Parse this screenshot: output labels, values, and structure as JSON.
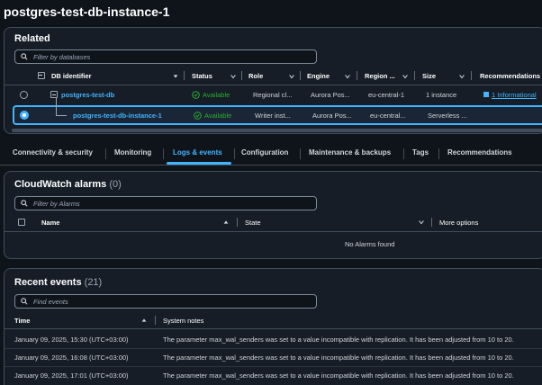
{
  "page": {
    "title": "postgres-test-db-instance-1"
  },
  "related": {
    "title": "Related",
    "search_placeholder": "Filter by databases",
    "columns": {
      "db_identifier": "DB identifier",
      "status": "Status",
      "role": "Role",
      "engine": "Engine",
      "region": "Region ...",
      "size": "Size",
      "recommendations": "Recommendations"
    },
    "rows": [
      {
        "identifier": "postgres-test-db",
        "status": "Available",
        "role": "Regional cl...",
        "engine": "Aurora Pos...",
        "region": "eu-central-1",
        "size": "1 instance",
        "recommendation": "1 Informational",
        "selected": false
      },
      {
        "identifier": "postgres-test-db-instance-1",
        "status": "Available",
        "role": "Writer inst...",
        "engine": "Aurora Pos...",
        "region": "eu-central...",
        "size": "Serverless ...",
        "recommendation": "",
        "selected": true
      }
    ]
  },
  "tabs": [
    {
      "label": "Connectivity & security",
      "active": false
    },
    {
      "label": "Monitoring",
      "active": false
    },
    {
      "label": "Logs & events",
      "active": true
    },
    {
      "label": "Configuration",
      "active": false
    },
    {
      "label": "Maintenance & backups",
      "active": false
    },
    {
      "label": "Tags",
      "active": false
    },
    {
      "label": "Recommendations",
      "active": false
    }
  ],
  "alarms": {
    "title": "CloudWatch alarms",
    "count": "(0)",
    "search_placeholder": "Filter by Alarms",
    "columns": {
      "name": "Name",
      "state": "State",
      "more": "More options"
    },
    "empty": "No Alarms found"
  },
  "events": {
    "title": "Recent events",
    "count": "(21)",
    "search_placeholder": "Find events",
    "columns": {
      "time": "Time",
      "notes": "System notes"
    },
    "rows": [
      {
        "time": "January 09, 2025, 15:30 (UTC+03:00)",
        "note": "The parameter max_wal_senders was set to a value incompatible with replication. It has been adjusted from 10 to 20."
      },
      {
        "time": "January 09, 2025, 16:08 (UTC+03:00)",
        "note": "The parameter max_wal_senders was set to a value incompatible with replication. It has been adjusted from 10 to 20."
      },
      {
        "time": "January 09, 2025, 17:01 (UTC+03:00)",
        "note": "The parameter max_wal_senders was set to a value incompatible with replication. It has been adjusted from 10 to 20."
      }
    ]
  },
  "colors": {
    "accent": "#42b4ff",
    "success": "#29ad32",
    "background": "#0f141a",
    "panel": "#161d26"
  }
}
